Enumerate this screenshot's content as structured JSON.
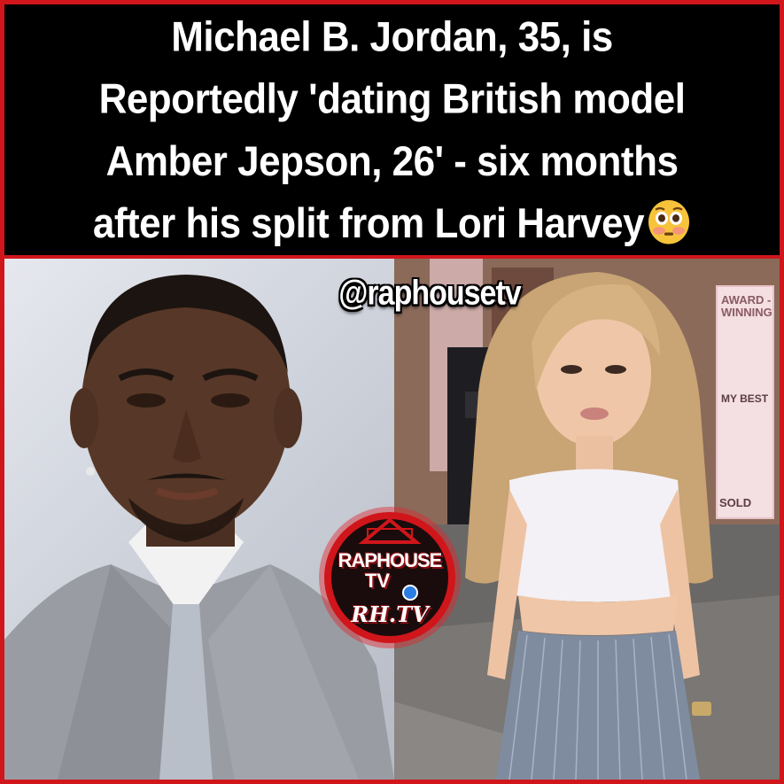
{
  "headline": {
    "lines": [
      "Michael B. Jordan, 35, is",
      "Reportedly 'dating British model",
      "Amber Jepson, 26' - six months",
      "after his split from Lori Harvey"
    ],
    "emoji_icon": "flushed-face-emoji"
  },
  "watermark": {
    "handle": "@raphousetv"
  },
  "logo": {
    "line1": "RAPHOUSE",
    "line2": "TV",
    "line3": "RH.TV"
  },
  "background_sign": {
    "top_text": "AWARD -WINNING",
    "middle_text": "MY BEST",
    "bottom_text": "SOLD"
  },
  "colors": {
    "border": "#d0161b",
    "headline_bg": "#000000",
    "headline_text": "#ffffff"
  }
}
